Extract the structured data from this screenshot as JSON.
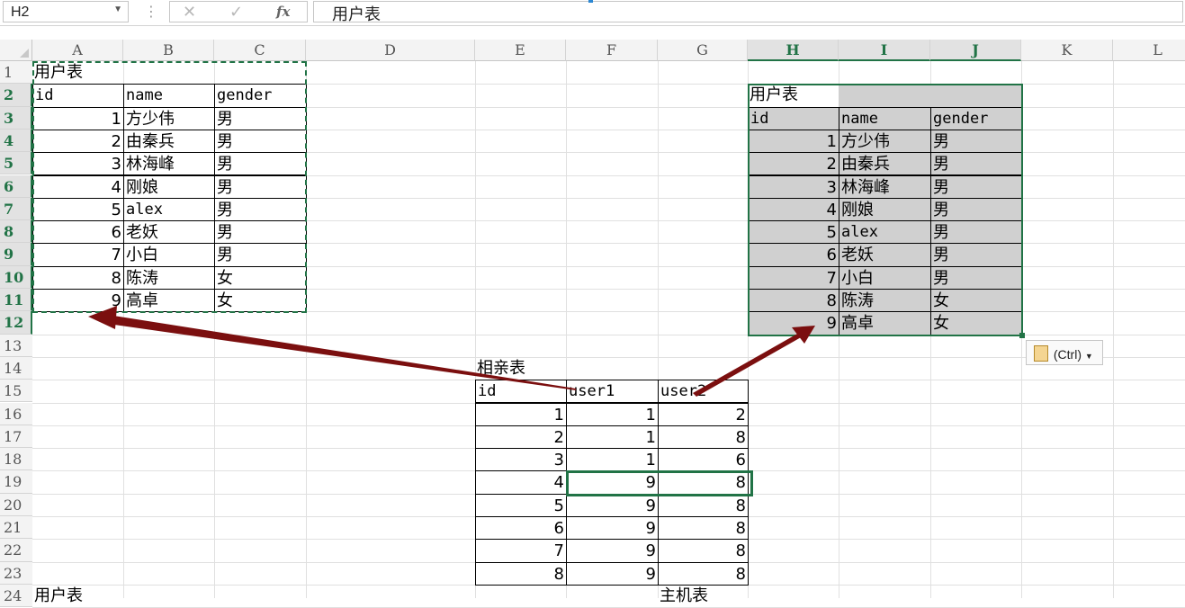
{
  "formula_bar": {
    "name_box": "H2",
    "cancel_icon": "✕",
    "enter_icon": "✓",
    "fx_label": "fx",
    "formula": "用户表"
  },
  "columns": [
    "A",
    "B",
    "C",
    "D",
    "E",
    "F",
    "G",
    "H",
    "I",
    "J",
    "K",
    "L"
  ],
  "selected_columns": [
    "H",
    "I",
    "J"
  ],
  "rows": [
    "1",
    "2",
    "3",
    "4",
    "5",
    "6",
    "7",
    "8",
    "9",
    "10",
    "11",
    "12",
    "13",
    "14",
    "15",
    "16",
    "17",
    "18",
    "19",
    "20",
    "21",
    "22",
    "23",
    "24"
  ],
  "selected_rows": [
    "2",
    "3",
    "4",
    "5",
    "6",
    "7",
    "8",
    "9",
    "10",
    "11",
    "12"
  ],
  "user_table": {
    "title": "用户表",
    "headers": [
      "id",
      "name",
      "gender"
    ],
    "rows": [
      [
        "1",
        "方少伟",
        "男"
      ],
      [
        "2",
        "由秦兵",
        "男"
      ],
      [
        "3",
        "林海峰",
        "男"
      ],
      [
        "4",
        "刚娘",
        "男"
      ],
      [
        "5",
        "alex",
        "男"
      ],
      [
        "6",
        "老妖",
        "男"
      ],
      [
        "7",
        "小白",
        "男"
      ],
      [
        "8",
        "陈涛",
        "女"
      ],
      [
        "9",
        "高卓",
        "女"
      ]
    ]
  },
  "pasted_table": {
    "title": "用户表",
    "headers": [
      "id",
      "name",
      "gender"
    ],
    "rows": [
      [
        "1",
        "方少伟",
        "男"
      ],
      [
        "2",
        "由秦兵",
        "男"
      ],
      [
        "3",
        "林海峰",
        "男"
      ],
      [
        "4",
        "刚娘",
        "男"
      ],
      [
        "5",
        "alex",
        "男"
      ],
      [
        "6",
        "老妖",
        "男"
      ],
      [
        "7",
        "小白",
        "男"
      ],
      [
        "8",
        "陈涛",
        "女"
      ],
      [
        "9",
        "高卓",
        "女"
      ]
    ]
  },
  "match_table": {
    "title": "相亲表",
    "headers": [
      "id",
      "user1",
      "user2"
    ],
    "rows": [
      [
        "1",
        "1",
        "2"
      ],
      [
        "2",
        "1",
        "8"
      ],
      [
        "3",
        "1",
        "6"
      ],
      [
        "4",
        "9",
        "8"
      ],
      [
        "5",
        "9",
        "8"
      ],
      [
        "6",
        "9",
        "8"
      ],
      [
        "7",
        "9",
        "8"
      ],
      [
        "8",
        "9",
        "8"
      ]
    ]
  },
  "row24": {
    "a": "用户表",
    "g": "主机表"
  },
  "paste_options": {
    "label": "(Ctrl)",
    "icon": "clipboard-icon"
  },
  "colors": {
    "accent": "#217346",
    "arrow": "#7b0f0f",
    "selection_fill": "#d0d0d0"
  }
}
